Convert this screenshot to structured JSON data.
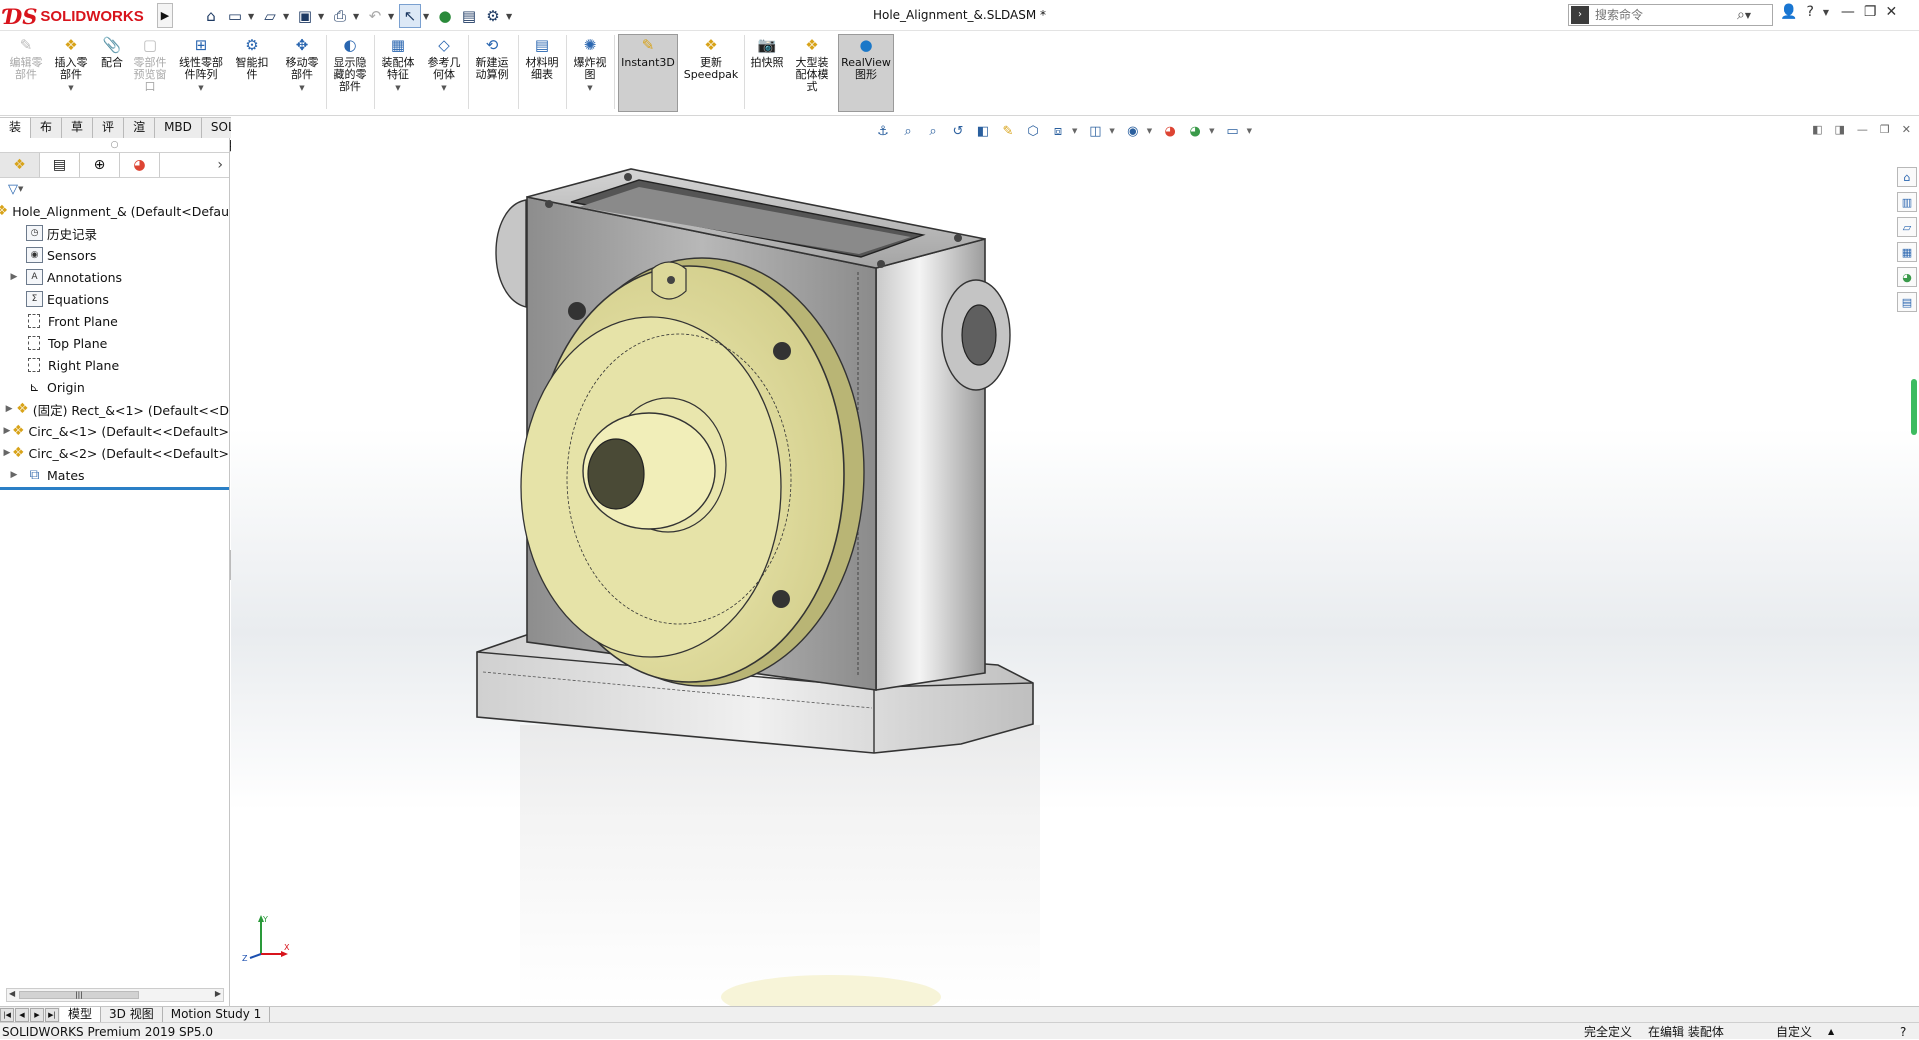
{
  "app": {
    "logo_ds": "ƊS",
    "logo_name": "SOLIDWORKS",
    "document_title": "Hole_Alignment_&.SLDASM *",
    "search_placeholder": "搜索命令"
  },
  "quick_access": [
    "home-icon",
    "new-doc-icon",
    "open-icon",
    "save-icon",
    "print-icon",
    "undo-icon",
    "select-icon",
    "traffic-light-icon",
    "file-props-icon",
    "options-icon"
  ],
  "ribbon": {
    "buttons": [
      {
        "label": "编辑零部件",
        "enabled": false
      },
      {
        "label": "插入零部件",
        "enabled": true
      },
      {
        "label": "配合",
        "enabled": true
      },
      {
        "label": "零部件预览窗口",
        "enabled": false
      },
      {
        "label": "线性零部件阵列",
        "enabled": true
      },
      {
        "label": "智能扣件",
        "enabled": true
      },
      {
        "label": "移动零部件",
        "enabled": true
      },
      {
        "label": "显示隐藏的零部件",
        "enabled": true
      },
      {
        "label": "装配体特征",
        "enabled": true
      },
      {
        "label": "参考几何体",
        "enabled": true
      },
      {
        "label": "新建运动算例",
        "enabled": true
      },
      {
        "label": "材料明细表",
        "enabled": true
      },
      {
        "label": "爆炸视图",
        "enabled": true
      },
      {
        "label": "Instant3D",
        "enabled": true,
        "active": true
      },
      {
        "label": "更新Speedpak",
        "enabled": true
      },
      {
        "label": "拍快照",
        "enabled": true
      },
      {
        "label": "大型装配体模式",
        "enabled": true
      },
      {
        "label": "RealView图形",
        "enabled": true,
        "active": true
      }
    ]
  },
  "command_tabs": [
    {
      "label": "装配体",
      "active": true
    },
    {
      "label": "布局"
    },
    {
      "label": "草图"
    },
    {
      "label": "评估"
    },
    {
      "label": "渲染工具"
    },
    {
      "label": "MBD"
    },
    {
      "label": "SOLIDWORKS 插件"
    }
  ],
  "feature_manager": {
    "tabs": [
      "featuremanager-icon",
      "propertymanager-icon",
      "configurationmanager-icon",
      "displaymanager-icon"
    ],
    "tree": [
      {
        "label": "Hole_Alignment_&  (Default<Defau",
        "icon": "assembly-icon",
        "expand": false,
        "root": true
      },
      {
        "label": "历史记录",
        "icon": "history-icon"
      },
      {
        "label": "Sensors",
        "icon": "sensors-icon"
      },
      {
        "label": "Annotations",
        "icon": "annotations-icon",
        "expand": true
      },
      {
        "label": "Equations",
        "icon": "equations-icon"
      },
      {
        "label": "Front Plane",
        "icon": "plane-icon"
      },
      {
        "label": "Top Plane",
        "icon": "plane-icon"
      },
      {
        "label": "Right Plane",
        "icon": "plane-icon"
      },
      {
        "label": "Origin",
        "icon": "origin-icon"
      },
      {
        "label": "(固定) Rect_&<1> (Default<<D",
        "icon": "part-icon",
        "expand": true
      },
      {
        "label": "Circ_&<1> (Default<<Default>",
        "icon": "part-icon",
        "expand": true
      },
      {
        "label": "Circ_&<2> (Default<<Default>",
        "icon": "part-icon",
        "expand": true
      },
      {
        "label": "Mates",
        "icon": "mates-icon",
        "expand": true
      }
    ]
  },
  "bottom_tabs": [
    {
      "label": "模型",
      "active": true
    },
    {
      "label": "3D 视图"
    },
    {
      "label": "Motion Study 1"
    }
  ],
  "status": {
    "product": "SOLIDWORKS Premium 2019 SP5.0",
    "definition": "完全定义",
    "editing": "在编辑 装配体",
    "units": "自定义"
  },
  "colors": {
    "brand_red": "#d8141c",
    "part_yellow": "#e9e6a4",
    "housing_grey": "#9c9c9c",
    "tree_bar_blue": "#2a7fc6"
  }
}
